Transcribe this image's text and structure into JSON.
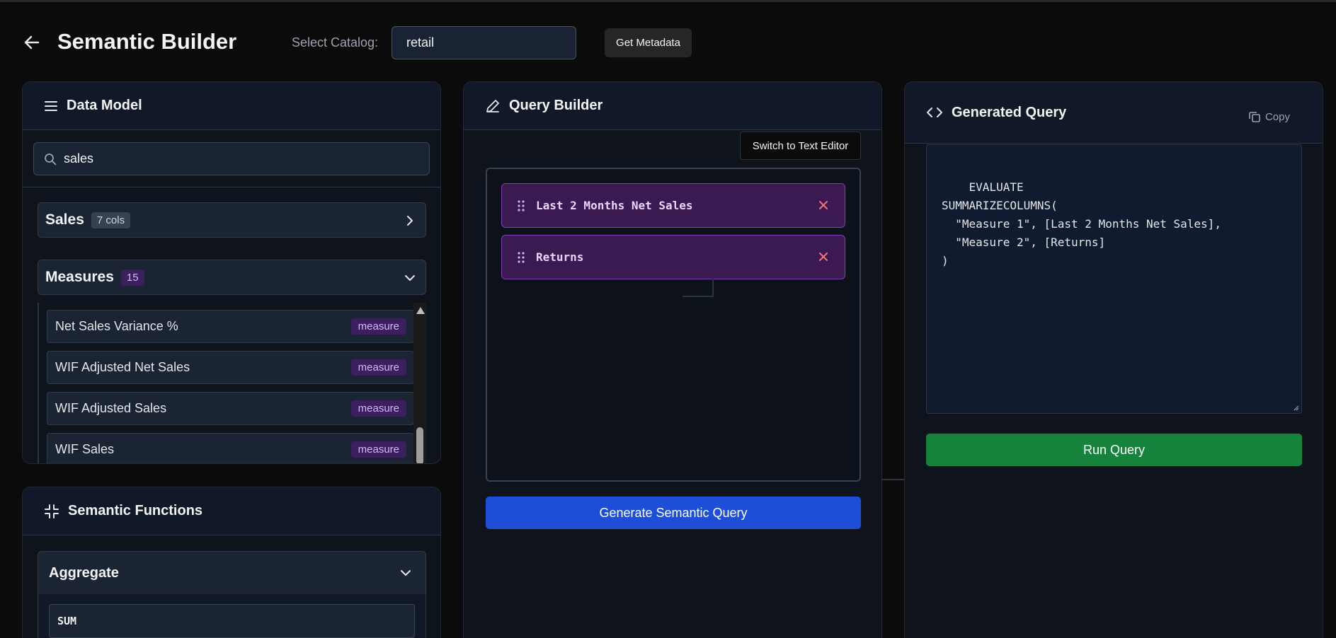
{
  "header": {
    "title": "Semantic Builder",
    "catalog_label": "Select Catalog:",
    "catalog_value": "retail",
    "metadata_button": "Get Metadata"
  },
  "data_model": {
    "title": "Data Model",
    "search_value": "sales",
    "groups": [
      {
        "name": "Sales",
        "count": "7 cols",
        "expanded": false
      },
      {
        "name": "Measures",
        "count": "15",
        "expanded": true
      }
    ],
    "measures": [
      {
        "name": "Net Sales Variance %",
        "tag": "measure"
      },
      {
        "name": "WIF Adjusted Net Sales",
        "tag": "measure"
      },
      {
        "name": "WIF Adjusted Sales",
        "tag": "measure"
      },
      {
        "name": "WIF Sales",
        "tag": "measure"
      }
    ]
  },
  "semantic_functions": {
    "title": "Semantic Functions",
    "group": "Aggregate",
    "items": [
      "SUM"
    ]
  },
  "query_builder": {
    "title": "Query Builder",
    "switch_label": "Switch to Text Editor",
    "chips": [
      "Last 2 Months Net Sales",
      "Returns"
    ],
    "generate_label": "Generate Semantic Query"
  },
  "generated_query": {
    "title": "Generated Query",
    "copy_label": "Copy",
    "code": "EVALUATE\nSUMMARIZECOLUMNS(\n  \"Measure 1\", [Last 2 Months Net Sales],\n  \"Measure 2\", [Returns]\n)",
    "run_label": "Run Query"
  },
  "colors": {
    "accent_blue": "#1d4ed8",
    "run_green": "#16833d",
    "measure_purple": "#d8b4fe",
    "remove_red": "#f87171"
  }
}
